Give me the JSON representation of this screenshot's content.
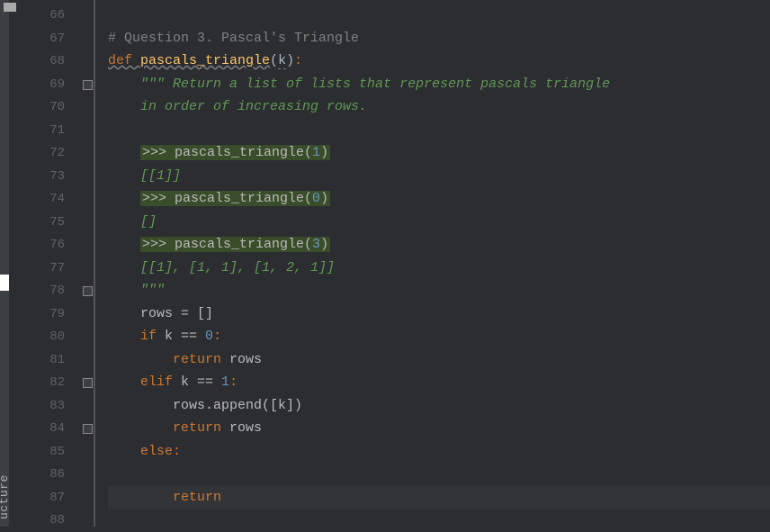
{
  "sidebar": {
    "vertical_label": "ucture"
  },
  "editor": {
    "gutter_start": 66,
    "lines": [
      {
        "num": 66,
        "tokens": []
      },
      {
        "num": 67,
        "tokens": [
          {
            "t": "# Question 3. Pascal's Triangle",
            "c": "c-comment"
          }
        ]
      },
      {
        "num": 68,
        "tokens": [
          {
            "t": "def ",
            "c": "c-keyword fn-decl"
          },
          {
            "t": "pascals_triangle",
            "c": "c-funcname fn-decl"
          },
          {
            "t": "(",
            "c": "c-default"
          },
          {
            "t": "k",
            "c": "c-default underline-squiggle"
          },
          {
            "t": ")",
            "c": "c-default"
          },
          {
            "t": ":",
            "c": "c-keyword"
          }
        ]
      },
      {
        "num": 69,
        "indent": 1,
        "tokens": [
          {
            "t": "\"\"\" Return a list of lists that represent pascals triangle",
            "c": "c-string"
          }
        ]
      },
      {
        "num": 70,
        "indent": 1,
        "tokens": [
          {
            "t": "in order of increasing rows.",
            "c": "c-string"
          }
        ]
      },
      {
        "num": 71,
        "tokens": []
      },
      {
        "num": 72,
        "indent": 1,
        "hl": true,
        "tokens": [
          {
            "t": ">>> pascals_triangle(",
            "c": "c-default2"
          },
          {
            "t": "1",
            "c": "c-number"
          },
          {
            "t": ")",
            "c": "c-default2"
          }
        ]
      },
      {
        "num": 73,
        "indent": 1,
        "tokens": [
          {
            "t": "[[1]]",
            "c": "c-string"
          }
        ]
      },
      {
        "num": 74,
        "indent": 1,
        "hl": true,
        "tokens": [
          {
            "t": ">>> pascals_triangle(",
            "c": "c-default2"
          },
          {
            "t": "0",
            "c": "c-number"
          },
          {
            "t": ")",
            "c": "c-default2"
          }
        ]
      },
      {
        "num": 75,
        "indent": 1,
        "tokens": [
          {
            "t": "[]",
            "c": "c-string"
          }
        ]
      },
      {
        "num": 76,
        "indent": 1,
        "hl": true,
        "tokens": [
          {
            "t": ">>> pascals_triangle(",
            "c": "c-default2"
          },
          {
            "t": "3",
            "c": "c-number"
          },
          {
            "t": ")",
            "c": "c-default2"
          }
        ]
      },
      {
        "num": 77,
        "indent": 1,
        "tokens": [
          {
            "t": "[[1], [1, 1], [1, 2, 1]]",
            "c": "c-string"
          }
        ]
      },
      {
        "num": 78,
        "indent": 1,
        "tokens": [
          {
            "t": "\"\"\"",
            "c": "c-string"
          }
        ]
      },
      {
        "num": 79,
        "indent": 1,
        "tokens": [
          {
            "t": "rows = []",
            "c": "c-default2"
          }
        ]
      },
      {
        "num": 80,
        "indent": 1,
        "tokens": [
          {
            "t": "if ",
            "c": "c-keyword"
          },
          {
            "t": "k == ",
            "c": "c-default2"
          },
          {
            "t": "0",
            "c": "c-number"
          },
          {
            "t": ":",
            "c": "c-keyword"
          }
        ]
      },
      {
        "num": 81,
        "indent": 2,
        "tokens": [
          {
            "t": "return ",
            "c": "c-keyword"
          },
          {
            "t": "rows",
            "c": "c-default2"
          }
        ]
      },
      {
        "num": 82,
        "indent": 1,
        "tokens": [
          {
            "t": "elif ",
            "c": "c-keyword"
          },
          {
            "t": "k == ",
            "c": "c-default2"
          },
          {
            "t": "1",
            "c": "c-number"
          },
          {
            "t": ":",
            "c": "c-keyword"
          }
        ]
      },
      {
        "num": 83,
        "indent": 2,
        "tokens": [
          {
            "t": "rows.append([k])",
            "c": "c-default2"
          }
        ]
      },
      {
        "num": 84,
        "indent": 2,
        "tokens": [
          {
            "t": "return ",
            "c": "c-keyword"
          },
          {
            "t": "rows",
            "c": "c-default2"
          }
        ]
      },
      {
        "num": 85,
        "indent": 1,
        "tokens": [
          {
            "t": "else",
            "c": "c-keyword"
          },
          {
            "t": ":",
            "c": "c-keyword"
          }
        ]
      },
      {
        "num": 86,
        "tokens": []
      },
      {
        "num": 87,
        "indent": 2,
        "current": true,
        "tokens": [
          {
            "t": "return",
            "c": "c-keyword"
          }
        ]
      },
      {
        "num": 88,
        "tokens": []
      }
    ],
    "fold_markers": [
      {
        "line": 69,
        "type": "down"
      },
      {
        "line": 78,
        "type": "up"
      },
      {
        "line": 82,
        "type": "down"
      },
      {
        "line": 84,
        "type": "up"
      }
    ]
  }
}
